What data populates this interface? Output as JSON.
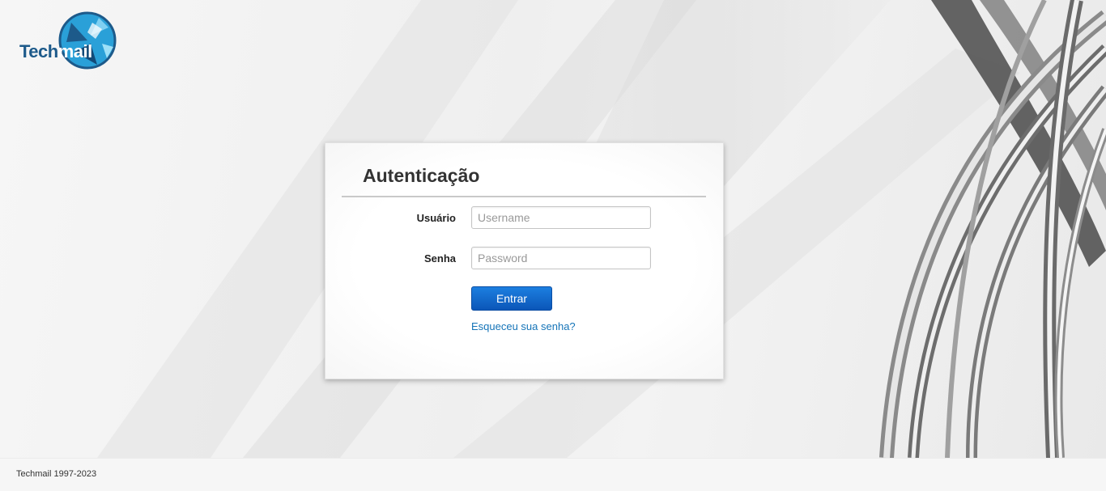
{
  "brand": {
    "logo_text_1": "Tech",
    "logo_text_2": "mail",
    "primary_color": "#1d5a8a",
    "accent_color": "#2aa0d8"
  },
  "login": {
    "title": "Autenticação",
    "username_label": "Usuário",
    "username_placeholder": "Username",
    "password_label": "Senha",
    "password_placeholder": "Password",
    "submit_label": "Entrar",
    "forgot_link": "Esqueceu sua senha?",
    "button_color": "#0b63c9"
  },
  "footer": {
    "copyright": "Techmail 1997-2023"
  }
}
